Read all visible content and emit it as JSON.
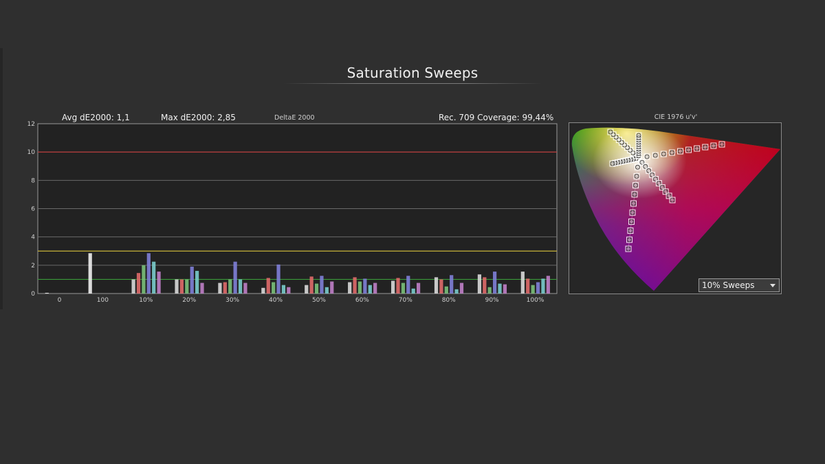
{
  "page_title": "Saturation Sweeps",
  "stats": {
    "avg": "Avg dE2000: 1,1",
    "max": "Max dE2000: 2,85",
    "metric": "DeltaE 2000",
    "coverage": "Rec. 709 Coverage: 99,44%"
  },
  "cie": {
    "title": "CIE 1976 u'v'",
    "selector_value": "10% Sweeps"
  },
  "chart_data": {
    "type": "bar",
    "ylim": [
      0,
      12
    ],
    "yticks": [
      "0",
      "2",
      "4",
      "6",
      "8",
      "10",
      "12"
    ],
    "categories": [
      "0",
      "100",
      "10%",
      "20%",
      "30%",
      "40%",
      "50%",
      "60%",
      "70%",
      "80%",
      "90%",
      "100%"
    ],
    "thresholds": [
      {
        "value": 10,
        "color": "#c83a3a"
      },
      {
        "value": 3,
        "color": "#c8b43a"
      },
      {
        "value": 1,
        "color": "#3a9a3a"
      }
    ],
    "series_colors": [
      "#d9d9d9",
      "#e06a6a",
      "#7ac07a",
      "#8080d8",
      "#7acccc",
      "#c080c8",
      "#d8d070"
    ],
    "groups": [
      {
        "category": "0",
        "values": [
          0.05,
          0,
          0,
          0,
          0,
          0,
          0
        ]
      },
      {
        "category": "100",
        "values": [
          2.85,
          0,
          0,
          0,
          0,
          0,
          0
        ]
      },
      {
        "category": "10%",
        "values": [
          1.0,
          1.45,
          2.0,
          2.85,
          2.25,
          1.55,
          0
        ]
      },
      {
        "category": "20%",
        "values": [
          1.0,
          1.0,
          1.0,
          1.9,
          1.6,
          0.75,
          0
        ]
      },
      {
        "category": "30%",
        "values": [
          0.75,
          0.8,
          1.0,
          2.25,
          1.0,
          0.75,
          0
        ]
      },
      {
        "category": "40%",
        "values": [
          0.4,
          1.1,
          0.8,
          2.05,
          0.6,
          0.45,
          0
        ]
      },
      {
        "category": "50%",
        "values": [
          0.6,
          1.2,
          0.7,
          1.25,
          0.45,
          0.85,
          0
        ]
      },
      {
        "category": "60%",
        "values": [
          0.8,
          1.15,
          0.85,
          1.05,
          0.6,
          0.75,
          0
        ]
      },
      {
        "category": "70%",
        "values": [
          0.9,
          1.1,
          0.75,
          1.25,
          0.35,
          0.75,
          0
        ]
      },
      {
        "category": "80%",
        "values": [
          1.15,
          1.0,
          0.5,
          1.3,
          0.3,
          0.75,
          0
        ]
      },
      {
        "category": "90%",
        "values": [
          1.35,
          1.15,
          0.45,
          1.55,
          0.7,
          0.65,
          0
        ]
      },
      {
        "category": "100%",
        "values": [
          1.55,
          1.05,
          0.6,
          0.8,
          1.05,
          1.25,
          0
        ]
      }
    ]
  }
}
